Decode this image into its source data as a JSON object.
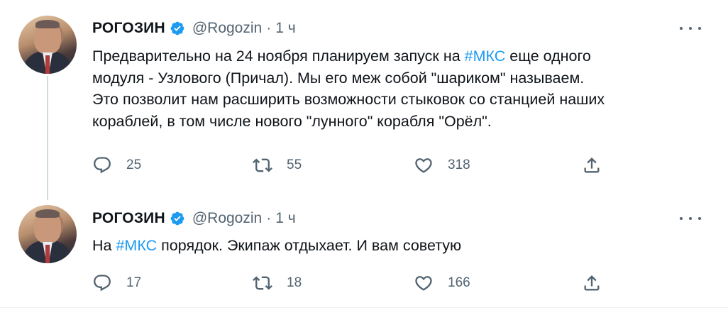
{
  "tweets": [
    {
      "author_name": "РОГОЗИН",
      "handle": "@Rogozin",
      "separator": "·",
      "time": "1 ч",
      "text_parts": [
        "Предварительно на 24 ноября планируем запуск на ",
        "#МКС",
        " еще одного",
        "модуля - Узлового (Причал). Мы его меж собой \"шариком\" называем.",
        "Это позволит нам расширить возможности стыковок со станцией наших",
        "кораблей, в том числе нового \"лунного\" корабля \"Орёл\"."
      ],
      "replies": "25",
      "retweets": "55",
      "likes": "318"
    },
    {
      "author_name": "РОГОЗИН",
      "handle": "@Rogozin",
      "separator": "·",
      "time": "1 ч",
      "text_parts": [
        "На ",
        "#МКС",
        " порядок. Экипаж отдыхает. И вам советую"
      ],
      "replies": "17",
      "retweets": "18",
      "likes": "166"
    }
  ],
  "icons": {
    "verified": "verified-badge-icon",
    "more": "more-dots-icon",
    "reply": "reply-icon",
    "retweet": "retweet-icon",
    "like": "heart-icon",
    "share": "share-icon"
  },
  "colors": {
    "accent": "#1d9bf0",
    "secondary_text": "#536471",
    "primary_text": "#0f1419",
    "thread_line": "#cfd9de"
  }
}
